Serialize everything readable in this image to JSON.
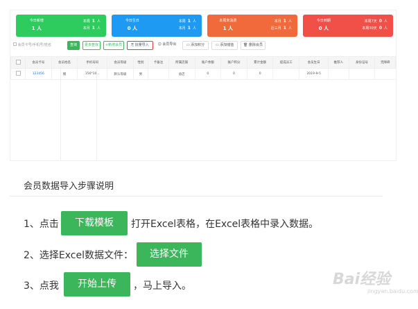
{
  "cards": [
    {
      "label": "今日新增",
      "value": "1 人",
      "r1a": "本周",
      "r1b": "1",
      "r1c": "人",
      "r2a": "本月",
      "r2b": "1",
      "r2c": "人",
      "color": "#2ecc5f"
    },
    {
      "label": "今日生日",
      "value": "0 人",
      "r1a": "本周",
      "r1b": "1",
      "r1c": "人",
      "r2a": "本月",
      "r2b": "1",
      "r2c": "人",
      "color": "#1e9af2"
    },
    {
      "label": "本周未消费",
      "value": "1 人",
      "r1a": "本月",
      "r1b": "1",
      "r1c": "人",
      "r2a": "近三月",
      "r2b": "1",
      "r2c": "人",
      "color": "#f06a3c"
    },
    {
      "label": "今日到期",
      "value": "0 人",
      "r1a": "本周7天",
      "r1b": "0",
      "r1c": "人",
      "r2a": "本周30天",
      "r2b": "0",
      "r2c": "人",
      "color": "#f05048"
    }
  ],
  "toolbar": {
    "search_placeholder": "会员卡号/手机号/姓名",
    "query": "查询",
    "advanced": "更多查找",
    "add_member": "+新增会员",
    "batch_import": "批量导入",
    "export": "会员导出",
    "add_points": "添加积分",
    "add_stored": "添加储值",
    "delete": "删除会员"
  },
  "table": {
    "headers": [
      "会员卡号",
      "会员姓名",
      "手机号码",
      "会员等级",
      "性别",
      "卡备注",
      "所属店铺",
      "账户余额",
      "账户积分",
      "累计金额",
      "提成员工",
      "会员生日",
      "推荐人",
      "身份证号",
      "无障碍"
    ],
    "row": [
      "123456",
      "猪",
      "156*10...",
      "默认等级",
      "男",
      "",
      "总店",
      "0",
      "0",
      "0",
      "",
      "2019-9-5",
      "",
      "",
      ""
    ]
  },
  "instructions": {
    "heading": "会员数据导入步骤说明",
    "step1_pre": "1、点击",
    "step1_btn": "下载模板",
    "step1_post": "打开Excel表格，在Excel表格中录入数据。",
    "step2_pre": "2、选择Excel数据文件：",
    "step2_btn": "选择文件",
    "step3_pre": "3、点我",
    "step3_btn": "开始上传",
    "step3_post": "，马上导入。"
  },
  "watermark": {
    "text": "Bai经验",
    "url": "jingyan.baidu.com"
  }
}
